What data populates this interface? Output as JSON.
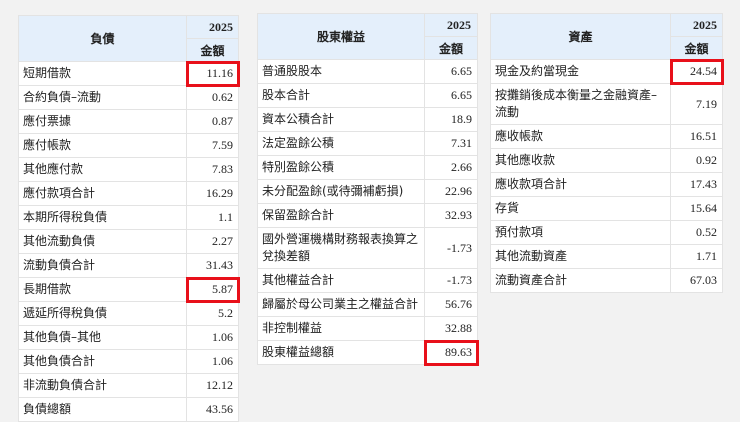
{
  "tables": [
    {
      "id": "t1",
      "category": "負債",
      "period": "2025",
      "amount_header": "金額",
      "rows": [
        {
          "label": "短期借款",
          "value": "11.16",
          "indent": 2,
          "highlight": true
        },
        {
          "label": "合約負債–流動",
          "value": "0.62",
          "indent": 2
        },
        {
          "label": "應付票據",
          "value": "0.87",
          "indent": 3
        },
        {
          "label": "應付帳款",
          "value": "7.59",
          "indent": 3
        },
        {
          "label": "其他應付款",
          "value": "7.83",
          "indent": 3
        },
        {
          "label": "應付款項合計",
          "value": "16.29",
          "indent": 2
        },
        {
          "label": "本期所得稅負債",
          "value": "1.1",
          "indent": 2
        },
        {
          "label": "其他流動負債",
          "value": "2.27",
          "indent": 2
        },
        {
          "label": "流動負債合計",
          "value": "31.43",
          "indent": 0
        },
        {
          "label": "長期借款",
          "value": "5.87",
          "indent": 2,
          "highlight": true
        },
        {
          "label": "遞延所得稅負債",
          "value": "5.2",
          "indent": 2
        },
        {
          "label": "其他負債–其他",
          "value": "1.06",
          "indent": 3
        },
        {
          "label": "其他負債合計",
          "value": "1.06",
          "indent": 2
        },
        {
          "label": "非流動負債合計",
          "value": "12.12",
          "indent": 1
        },
        {
          "label": "負債總額",
          "value": "43.56",
          "indent": 0
        }
      ]
    },
    {
      "id": "t2",
      "category": "股東權益",
      "period": "2025",
      "amount_header": "金額",
      "rows": [
        {
          "label": "普通股股本",
          "value": "6.65",
          "indent": 2
        },
        {
          "label": "股本合計",
          "value": "6.65",
          "indent": 1
        },
        {
          "label": "資本公積合計",
          "value": "18.9",
          "indent": 1
        },
        {
          "label": "法定盈餘公積",
          "value": "7.31",
          "indent": 2
        },
        {
          "label": "特別盈餘公積",
          "value": "2.66",
          "indent": 2
        },
        {
          "label": "未分配盈餘(或待彌補虧損)",
          "value": "22.96",
          "indent": 2
        },
        {
          "label": "保留盈餘合計",
          "value": "32.93",
          "indent": 1
        },
        {
          "label": "國外營運機構財務報表換算之兌換差額",
          "value": "-1.73",
          "indent": 2,
          "negative": true
        },
        {
          "label": "其他權益合計",
          "value": "-1.73",
          "indent": 1,
          "negative": true
        },
        {
          "label": "歸屬於母公司業主之權益合計",
          "value": "56.76",
          "indent": 1
        },
        {
          "label": "非控制權益",
          "value": "32.88",
          "indent": 1
        },
        {
          "label": "股東權益總額",
          "value": "89.63",
          "indent": 0,
          "highlight": true
        }
      ]
    },
    {
      "id": "t3",
      "category": "資產",
      "period": "2025",
      "amount_header": "金額",
      "rows": [
        {
          "label": "現金及約當現金",
          "value": "24.54",
          "indent": 2,
          "highlight": true
        },
        {
          "label": "按攤銷後成本衡量之金融資產–流動",
          "value": "7.19",
          "indent": 2
        },
        {
          "label": "應收帳款",
          "value": "16.51",
          "indent": 3
        },
        {
          "label": "其他應收款",
          "value": "0.92",
          "indent": 3
        },
        {
          "label": "應收款項合計",
          "value": "17.43",
          "indent": 2
        },
        {
          "label": "存貨",
          "value": "15.64",
          "indent": 2
        },
        {
          "label": "預付款項",
          "value": "0.52",
          "indent": 2
        },
        {
          "label": "其他流動資產",
          "value": "1.71",
          "indent": 2
        },
        {
          "label": "流動資產合計",
          "value": "67.03",
          "indent": 1
        }
      ]
    }
  ],
  "colors": {
    "header_bg": "#e4effb",
    "category_text": "#2121d6",
    "highlight": "#e8101a",
    "negative": "#e0242b"
  }
}
